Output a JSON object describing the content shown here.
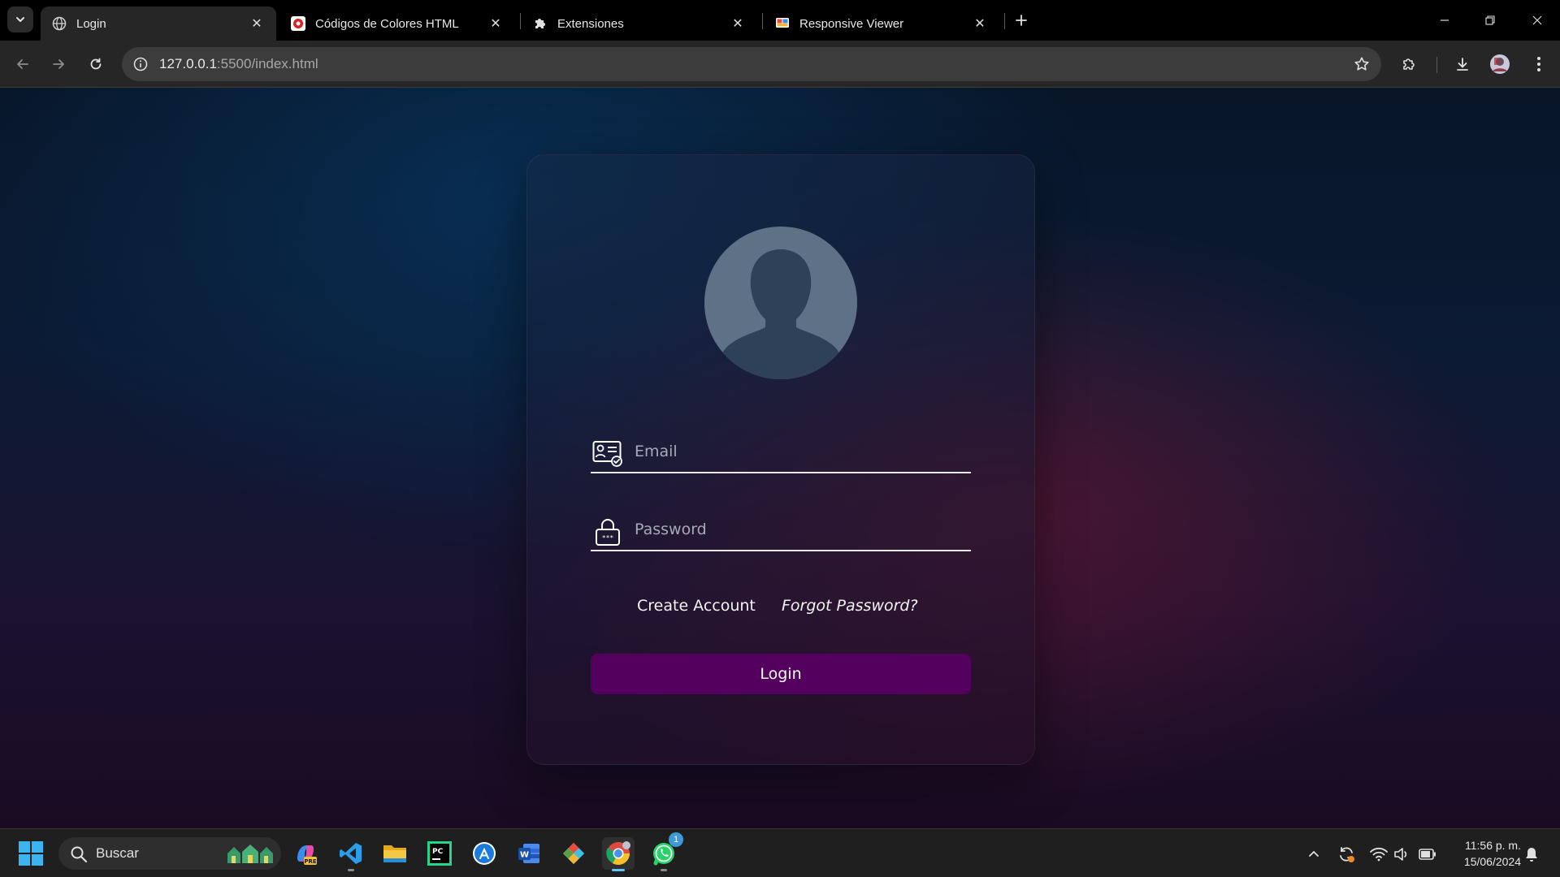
{
  "browser": {
    "tabs": [
      {
        "title": "Login",
        "favicon": "globe-icon",
        "active": true
      },
      {
        "title": "Códigos de Colores HTML",
        "favicon": "color-codes-icon",
        "active": false
      },
      {
        "title": "Extensiones",
        "favicon": "puzzle-icon",
        "active": false
      },
      {
        "title": "Responsive Viewer",
        "favicon": "responsive-viewer-icon",
        "active": false
      }
    ],
    "address": {
      "host": "127.0.0.1",
      "rest": ":5500/index.html"
    }
  },
  "login": {
    "email_placeholder": "Email",
    "password_placeholder": "Password",
    "create_account": "Create Account",
    "forgot_password": "Forgot Password?",
    "login_button": "Login"
  },
  "taskbar": {
    "search_label": "Buscar",
    "whatsapp_badge": "1",
    "time": "11:56 p. m.",
    "date": "15/06/2024"
  },
  "colors": {
    "login_button": "#54005e",
    "avatar_bg": "#5f7187",
    "avatar_silhouette": "#2f4158",
    "field_line": "#e9e9e9"
  }
}
